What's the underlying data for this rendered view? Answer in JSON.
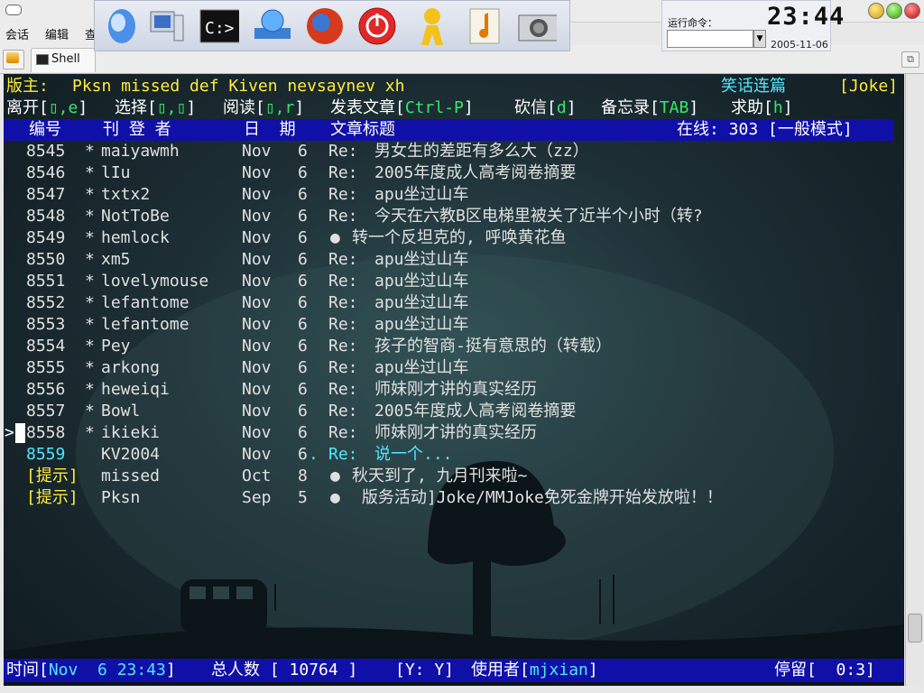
{
  "menu": {
    "items": [
      "会话",
      "编辑",
      "查"
    ]
  },
  "tab": {
    "label": "Shell"
  },
  "launcher": {
    "icons": [
      "quicktime-icon",
      "computer-icon",
      "terminal-icon",
      "network-icon",
      "browser-icon",
      "power-icon",
      "user-icon",
      "music-icon",
      "camera-icon"
    ]
  },
  "run": {
    "label": "运行命令：",
    "value": ""
  },
  "clock": {
    "time": "23:44",
    "date": "2005-11-06"
  },
  "board": {
    "moderator_label": "版主: ",
    "moderators": "Pksn missed def Kiven nevsaynev xh",
    "board_title": "笑话连篇",
    "board_id": "[Joke]"
  },
  "commands": [
    {
      "prefix": "离开[",
      "key": "▯,e",
      "suffix": "] "
    },
    {
      "prefix": "选择[",
      "key": "▯,▯",
      "suffix": "] "
    },
    {
      "prefix": "阅读[",
      "key": "▯,r",
      "suffix": "] "
    },
    {
      "prefix": "发表文章[",
      "key": "Ctrl-P",
      "suffix": "] "
    },
    {
      "prefix": "砍信[",
      "key": "d",
      "suffix": "] "
    },
    {
      "prefix": "备忘录[",
      "key": "TAB",
      "suffix": "] "
    },
    {
      "prefix": "求助[",
      "key": "h",
      "suffix": "]"
    }
  ],
  "columns": {
    "num": "编号",
    "author": "刊 登 者",
    "date": "日  期",
    "title": "文章标题",
    "online": "在线: 303 [一般模式]"
  },
  "posts": [
    {
      "num": "8545",
      "mark": "*",
      "author": "maiyawmh",
      "month": "Nov",
      "day": "6",
      "prefix": "Re:",
      "title": "男女生的差距有多么大（zz）"
    },
    {
      "num": "8546",
      "mark": "*",
      "author": "lIu",
      "month": "Nov",
      "day": "6",
      "prefix": "Re:",
      "title": "2005年度成人高考阅卷摘要"
    },
    {
      "num": "8547",
      "mark": "*",
      "author": "txtx2",
      "month": "Nov",
      "day": "6",
      "prefix": "Re:",
      "title": "apu坐过山车"
    },
    {
      "num": "8548",
      "mark": "*",
      "author": "NotToBe",
      "month": "Nov",
      "day": "6",
      "prefix": "Re:",
      "title": "今天在六教B区电梯里被关了近半个小时（转?"
    },
    {
      "num": "8549",
      "mark": "*",
      "author": "hemlock",
      "month": "Nov",
      "day": "6",
      "prefix": "●",
      "title": "转一个反坦克的, 呼唤黄花鱼"
    },
    {
      "num": "8550",
      "mark": "*",
      "author": "xm5",
      "month": "Nov",
      "day": "6",
      "prefix": "Re:",
      "title": "apu坐过山车"
    },
    {
      "num": "8551",
      "mark": "*",
      "author": "lovelymouse",
      "month": "Nov",
      "day": "6",
      "prefix": "Re:",
      "title": "apu坐过山车"
    },
    {
      "num": "8552",
      "mark": "*",
      "author": "lefantome",
      "month": "Nov",
      "day": "6",
      "prefix": "Re:",
      "title": "apu坐过山车"
    },
    {
      "num": "8553",
      "mark": "*",
      "author": "lefantome",
      "month": "Nov",
      "day": "6",
      "prefix": "Re:",
      "title": "apu坐过山车"
    },
    {
      "num": "8554",
      "mark": "*",
      "author": "Pey",
      "month": "Nov",
      "day": "6",
      "prefix": "Re:",
      "title": "孩子的智商-挺有意思的（转载）"
    },
    {
      "num": "8555",
      "mark": "*",
      "author": "arkong",
      "month": "Nov",
      "day": "6",
      "prefix": "Re:",
      "title": "apu坐过山车"
    },
    {
      "num": "8556",
      "mark": "*",
      "author": "heweiqi",
      "month": "Nov",
      "day": "6",
      "prefix": "Re:",
      "title": "师妹刚才讲的真实经历"
    },
    {
      "num": "8557",
      "mark": "*",
      "author": "Bowl",
      "month": "Nov",
      "day": "6",
      "prefix": "Re:",
      "title": "2005年度成人高考阅卷摘要"
    },
    {
      "num": "8558",
      "mark": "*",
      "author": "ikieki",
      "month": "Nov",
      "day": "6",
      "prefix": "Re:",
      "title": "师妹刚才讲的真实经历"
    }
  ],
  "selected": {
    "pointer": ">"
  },
  "new_post": {
    "num": "8559",
    "author": "KV2004",
    "month": "Nov",
    "day": "6",
    "dot": ".",
    "prefix": "Re:",
    "title": "说一个..."
  },
  "notices": [
    {
      "tag": "[提示]",
      "author": "missed",
      "month": "Oct",
      "day": "8",
      "prefix": "●",
      "title": "秋天到了, 九月刊来啦~"
    },
    {
      "tag": "[提示]",
      "author": "Pksn",
      "month": "Sep",
      "day": "5",
      "prefix": "●",
      "title": " 版务活动]Joke/MMJoke免死金牌开始发放啦！！"
    }
  ],
  "status": {
    "time_label": "时间[",
    "time_value": "Nov  6 23:43",
    "time_close": "] ",
    "users_label": "总人数 [ ",
    "users_value": "10764",
    "users_close": " ] ",
    "yy": "[Y: Y] ",
    "user_label": "使用者[",
    "user_value": "mjxian",
    "user_close": "]",
    "stay_label": "停留[",
    "stay_value": "  0:3",
    "stay_close": "]"
  }
}
